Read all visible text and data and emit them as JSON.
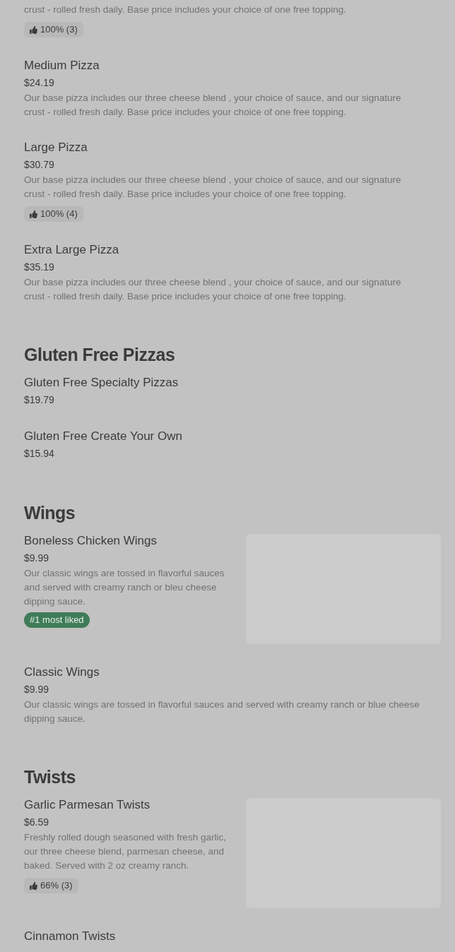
{
  "sections": [
    {
      "items": [
        {
          "description": "crust - rolled fresh daily. Base price includes your choice of one free topping.",
          "rating": "100% (3)"
        },
        {
          "name": "Medium Pizza",
          "price": "$24.19",
          "description": "Our base pizza includes our three cheese blend , your choice of sauce, and our signature crust - rolled fresh daily. Base price includes your choice of one free topping."
        },
        {
          "name": "Large Pizza",
          "price": "$30.79",
          "description": "Our base pizza includes our three cheese blend , your choice of sauce, and our signature crust - rolled fresh daily. Base price includes your choice of one free topping.",
          "rating": "100% (4)"
        },
        {
          "name": "Extra Large Pizza",
          "price": "$35.19",
          "description": "Our base pizza includes our three cheese blend , your choice of sauce, and our signature crust - rolled fresh daily. Base price includes your choice of one free topping."
        }
      ]
    },
    {
      "title": "Gluten Free Pizzas",
      "items": [
        {
          "name": "Gluten Free Specialty Pizzas",
          "price": "$19.79"
        },
        {
          "name": "Gluten Free Create Your Own",
          "price": "$15.94"
        }
      ]
    },
    {
      "title": "Wings",
      "items": [
        {
          "name": "Boneless Chicken Wings",
          "price": "$9.99",
          "description": "Our classic wings are tossed in flavorful sauces and served with creamy ranch or bleu cheese dipping sauce.",
          "tag": "#1 most liked"
        },
        {
          "name": "Classic Wings",
          "price": "$9.99",
          "description": "Our classic wings are tossed in flavorful sauces and served with creamy ranch or blue cheese dipping sauce."
        }
      ]
    },
    {
      "title": "Twists",
      "items": [
        {
          "name": "Garlic Parmesan Twists",
          "price": "$6.59",
          "description": "Freshly rolled dough seasoned with fresh garlic, our three cheese blend, parmesan cheese, and baked. Served with 2 oz creamy ranch.",
          "rating": "66% (3)"
        },
        {
          "name": "Cinnamon Twists"
        }
      ]
    }
  ]
}
